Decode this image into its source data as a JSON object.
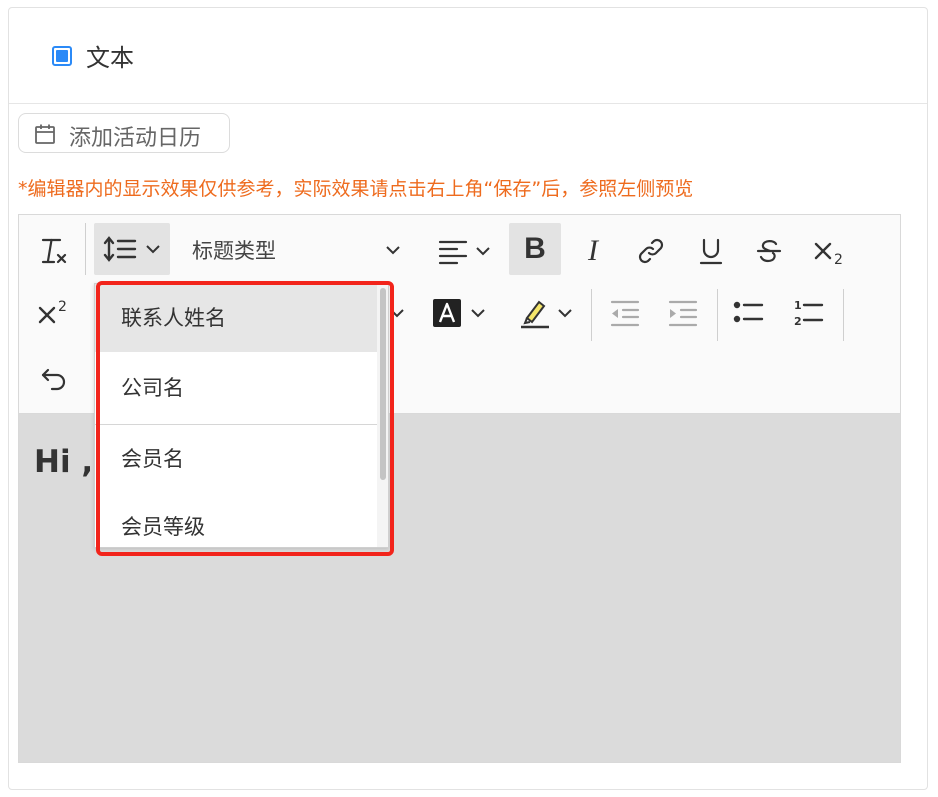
{
  "header": {
    "checkbox_checked": true,
    "label": "文本"
  },
  "calendar_button": {
    "label": "添加活动日历",
    "icon": "calendar-icon"
  },
  "warning": {
    "text": "*编辑器内的显示效果仅供参考，实际效果请点击右上角“保存”后，参照左侧预览",
    "color": "#ee6b1e"
  },
  "toolbar": {
    "heading_select": {
      "label": "标题类型"
    },
    "icons": [
      "clear-format-icon",
      "line-height-icon",
      "align-icon",
      "bold-icon",
      "italic-icon",
      "link-icon",
      "underline-icon",
      "strikethrough-icon",
      "subscript-icon",
      "superscript-icon",
      "font-color-icon",
      "highlight-icon",
      "outdent-icon",
      "indent-icon",
      "bullet-list-icon",
      "numbered-list-icon",
      "undo-icon"
    ]
  },
  "editor": {
    "content_text": "Hi ,"
  },
  "dropdown": {
    "items": [
      {
        "label": "联系人姓名",
        "hovered": true
      },
      {
        "label": "公司名",
        "hovered": false
      },
      {
        "label": "会员名",
        "hovered": false
      },
      {
        "label": "会员等级",
        "hovered": false
      }
    ]
  },
  "colors": {
    "accent": "#2b8af7",
    "highlight_border": "#f2241b",
    "editor_bg": "#dbdbdb"
  }
}
